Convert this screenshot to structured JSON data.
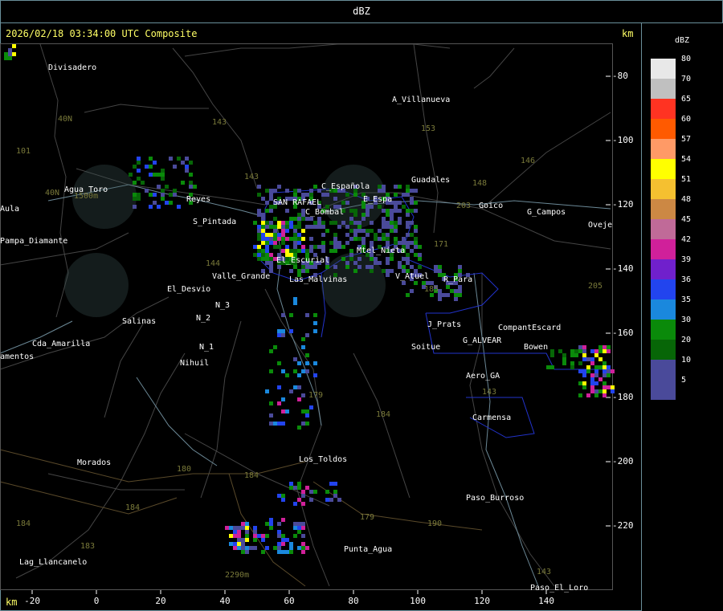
{
  "header": {
    "title": "dBZ"
  },
  "timestamp": "2026/02/18 03:34:00 UTC Composite",
  "km_label_top": "km",
  "km_label_bottom": "km",
  "x_ticks": [
    {
      "label": "-20",
      "value": -20
    },
    {
      "label": "0",
      "value": 0
    },
    {
      "label": "20",
      "value": 20
    },
    {
      "label": "40",
      "value": 40
    },
    {
      "label": "60",
      "value": 60
    },
    {
      "label": "80",
      "value": 80
    },
    {
      "label": "100",
      "value": 100
    },
    {
      "label": "120",
      "value": 120
    },
    {
      "label": "140",
      "value": 140
    }
  ],
  "y_ticks": [
    {
      "label": "-80",
      "value": -80
    },
    {
      "label": "-100",
      "value": -100
    },
    {
      "label": "-120",
      "value": -120
    },
    {
      "label": "-140",
      "value": -140
    },
    {
      "label": "-160",
      "value": -160
    },
    {
      "label": "-180",
      "value": -180
    },
    {
      "label": "-200",
      "value": -200
    },
    {
      "label": "-220",
      "value": -220
    }
  ],
  "legend": {
    "unit": "dBZ",
    "levels": [
      {
        "label": "80",
        "color": "#e8e8e8"
      },
      {
        "label": "70",
        "color": "#c0c0c0"
      },
      {
        "label": "65",
        "color": "#ff3322"
      },
      {
        "label": "60",
        "color": "#ff5a00"
      },
      {
        "label": "57",
        "color": "#ff9a66"
      },
      {
        "label": "54",
        "color": "#ffff00"
      },
      {
        "label": "51",
        "color": "#f5c030"
      },
      {
        "label": "48",
        "color": "#cc8844"
      },
      {
        "label": "45",
        "color": "#c06a98"
      },
      {
        "label": "42",
        "color": "#d0209a"
      },
      {
        "label": "39",
        "color": "#7020cc"
      },
      {
        "label": "36",
        "color": "#2244ee"
      },
      {
        "label": "35",
        "color": "#1a88dd"
      },
      {
        "label": "30",
        "color": "#0a8a0a"
      },
      {
        "label": "20",
        "color": "#076607"
      },
      {
        "label": "10",
        "color": "#4a4a9a"
      },
      {
        "label": "5",
        "color": "#4a4a9a"
      }
    ]
  },
  "places": [
    {
      "name": "Divisadero",
      "x": -15,
      "y": -76
    },
    {
      "name": "A_Villanueva",
      "x": 92,
      "y": -86
    },
    {
      "name": "Guadales",
      "x": 98,
      "y": -111
    },
    {
      "name": "Goico",
      "x": 119,
      "y": -119
    },
    {
      "name": "G_Campos",
      "x": 134,
      "y": -121
    },
    {
      "name": "Oveje",
      "x": 153,
      "y": -125
    },
    {
      "name": "Agua_Toro",
      "x": -10,
      "y": -114
    },
    {
      "name": "Reyes",
      "x": 28,
      "y": -117
    },
    {
      "name": "S_Pintada",
      "x": 30,
      "y": -124
    },
    {
      "name": "Pampa_Diamante",
      "x": -30,
      "y": -130
    },
    {
      "name": "Aula",
      "x": -30,
      "y": -120
    },
    {
      "name": "C_Española",
      "x": 70,
      "y": -113
    },
    {
      "name": "E_Espa",
      "x": 83,
      "y": -117
    },
    {
      "name": "C_Bombal",
      "x": 65,
      "y": -121
    },
    {
      "name": "SAN RAFAEL",
      "x": 55,
      "y": -118
    },
    {
      "name": "Mtel_Nieta",
      "x": 81,
      "y": -133
    },
    {
      "name": "El_Escurial",
      "x": 56,
      "y": -136
    },
    {
      "name": "El_Desvio",
      "x": 22,
      "y": -145
    },
    {
      "name": "Valle_Grande",
      "x": 36,
      "y": -141
    },
    {
      "name": "Las_Malvinas",
      "x": 60,
      "y": -142
    },
    {
      "name": "V_Atuel",
      "x": 93,
      "y": -141
    },
    {
      "name": "R_Para",
      "x": 108,
      "y": -142
    },
    {
      "name": "J_Prats",
      "x": 103,
      "y": -156
    },
    {
      "name": "CompantEscard",
      "x": 125,
      "y": -157
    },
    {
      "name": "Salinas",
      "x": 8,
      "y": -155
    },
    {
      "name": "N_2",
      "x": 31,
      "y": -154
    },
    {
      "name": "N_3",
      "x": 37,
      "y": -150
    },
    {
      "name": "N_1",
      "x": 32,
      "y": -163
    },
    {
      "name": "Nihuil",
      "x": 26,
      "y": -168
    },
    {
      "name": "Cda_Amarilla",
      "x": -20,
      "y": -162
    },
    {
      "name": "amentos",
      "x": -30,
      "y": -166
    },
    {
      "name": "G_ALVEAR",
      "x": 114,
      "y": -161
    },
    {
      "name": "Soitue",
      "x": 98,
      "y": -163
    },
    {
      "name": "Bowen",
      "x": 133,
      "y": -163
    },
    {
      "name": "Aero_GA",
      "x": 115,
      "y": -172
    },
    {
      "name": "Carmensa",
      "x": 117,
      "y": -185
    },
    {
      "name": "Morados",
      "x": -6,
      "y": -199
    },
    {
      "name": "Los_Toldos",
      "x": 63,
      "y": -198
    },
    {
      "name": "Paso_Burroso",
      "x": 115,
      "y": -210
    },
    {
      "name": "Punta_Agua",
      "x": 77,
      "y": -226
    },
    {
      "name": "Lag_Llancanelo",
      "x": -24,
      "y": -230
    },
    {
      "name": "Paso_El_Loro",
      "x": 135,
      "y": -238
    }
  ],
  "roads": [
    {
      "name": "40N",
      "x": -12,
      "y": -92
    },
    {
      "name": "40N",
      "x": -16,
      "y": -115
    },
    {
      "name": "101",
      "x": -25,
      "y": -102
    },
    {
      "name": "143",
      "x": 36,
      "y": -93
    },
    {
      "name": "143",
      "x": 46,
      "y": -110
    },
    {
      "name": "153",
      "x": 101,
      "y": -95
    },
    {
      "name": "146",
      "x": 132,
      "y": -105
    },
    {
      "name": "148",
      "x": 117,
      "y": -112
    },
    {
      "name": "203",
      "x": 112,
      "y": -119
    },
    {
      "name": "171",
      "x": 105,
      "y": -131
    },
    {
      "name": "185",
      "x": 102,
      "y": -145
    },
    {
      "name": "144",
      "x": 34,
      "y": -137
    },
    {
      "name": "143",
      "x": 120,
      "y": -177
    },
    {
      "name": "179",
      "x": 66,
      "y": -178
    },
    {
      "name": "184",
      "x": 87,
      "y": -184
    },
    {
      "name": "180",
      "x": 25,
      "y": -201
    },
    {
      "name": "184",
      "x": 46,
      "y": -203
    },
    {
      "name": "184",
      "x": 9,
      "y": -213
    },
    {
      "name": "184",
      "x": -25,
      "y": -218
    },
    {
      "name": "183",
      "x": -5,
      "y": -225
    },
    {
      "name": "190",
      "x": 103,
      "y": -218
    },
    {
      "name": "179",
      "x": 82,
      "y": -216
    },
    {
      "name": "143",
      "x": 137,
      "y": -233
    },
    {
      "name": "205",
      "x": 153,
      "y": -144
    },
    {
      "name": "2290m",
      "x": 40,
      "y": -234
    },
    {
      "name": "1500m",
      "x": -7,
      "y": -116
    }
  ]
}
